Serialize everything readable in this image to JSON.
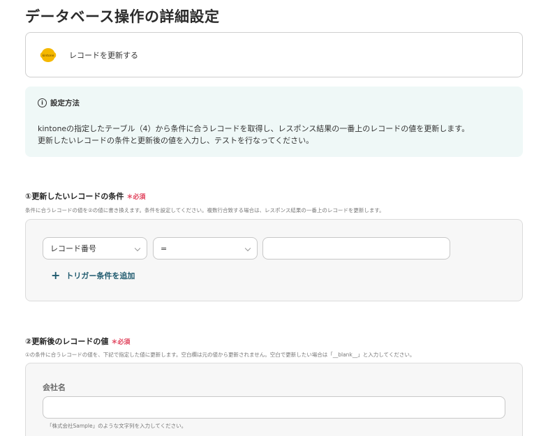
{
  "page": {
    "title": "データベース操作の詳細設定"
  },
  "app": {
    "logo_icon": "kintone-logo",
    "logo_text": "kintone",
    "action": "レコードを更新する",
    "brand_color": "#f5b800"
  },
  "info": {
    "heading": "設定方法",
    "line1": "kintoneの指定したテーブル（4）から条件に合うレコードを取得し、レスポンス結果の一番上のレコードの値を更新します。",
    "line2": "更新したいレコードの条件と更新後の値を入力し、テストを行なってください。"
  },
  "section1": {
    "label": "①更新したいレコードの条件",
    "required": "必須",
    "hint": "条件に合うレコードの値を②の値に書き換えます。条件を設定してください。複数行合致する場合は、レスポンス結果の一番上のレコードを更新します。",
    "field_select": "レコード番号",
    "operator_select": "=",
    "value_input": "",
    "add_condition": "トリガー条件を追加"
  },
  "section2": {
    "label": "②更新後のレコードの値",
    "required": "必須",
    "hint": "①の条件に合うレコードの値を、下記で指定した値に更新します。空白欄は元の値から更新されません。空白で更新したい場合は「__blank__」と入力してください。",
    "field_label": "会社名",
    "field_value": "",
    "field_hint": "「株式会社Sample」のような文字列を入力してください。"
  }
}
